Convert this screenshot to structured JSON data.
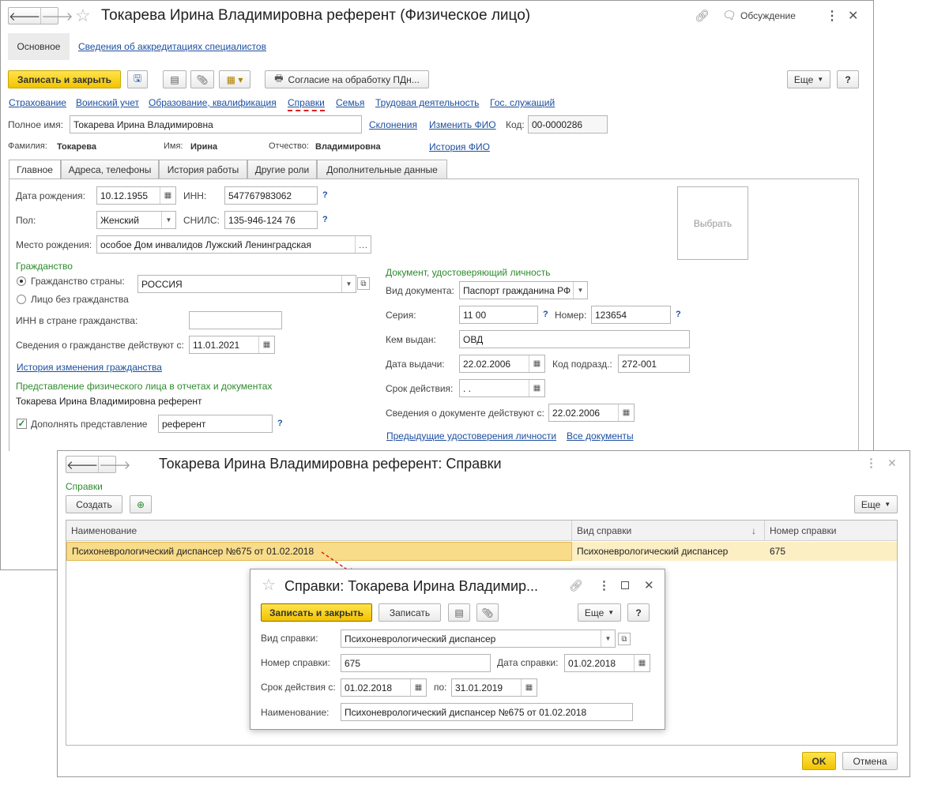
{
  "main": {
    "title": "Токарева Ирина Владимировна референт (Физическое лицо)",
    "discussion": "Обсуждение",
    "top_tabs": [
      "Основное",
      "Сведения об аккредитациях специалистов"
    ],
    "save_close": "Записать и закрыть",
    "consent": "Согласие на обработку ПДн...",
    "more": "Еще",
    "help": "?",
    "links": [
      "Страхование",
      "Воинский учет",
      "Образование, квалификация",
      "Справки",
      "Семья",
      "Трудовая деятельность",
      "Гос. служащий"
    ],
    "full_name_label": "Полное имя:",
    "full_name": "Токарева Ирина Владимировна",
    "declensions": "Склонения",
    "change_fio": "Изменить ФИО",
    "code_label": "Код:",
    "code": "00-0000286",
    "surname_label": "Фамилия:",
    "surname": "Токарева",
    "name_label": "Имя:",
    "name": "Ирина",
    "patronymic_label": "Отчество:",
    "patronymic": "Владимировна",
    "fio_history": "История ФИО",
    "tabs": [
      "Главное",
      "Адреса, телефоны",
      "История работы",
      "Другие роли",
      "Дополнительные данные"
    ],
    "birth_date_label": "Дата рождения:",
    "birth_date": "10.12.1955",
    "inn_label": "ИНН:",
    "inn": "547767983062",
    "sex_label": "Пол:",
    "sex": "Женский",
    "snils_label": "СНИЛС:",
    "snils": "135-946-124 76",
    "birth_place_label": "Место рождения:",
    "birth_place": "особое  Дом инвалидов  Лужский  Ленинградская",
    "photo": "Выбрать",
    "citizenship_header": "Гражданство",
    "citizenship_country_label": "Гражданство страны:",
    "citizenship_country": "РОССИЯ",
    "stateless_label": "Лицо без гражданства",
    "inn_foreign_label": "ИНН в стране гражданства:",
    "citizenship_since_label": "Сведения о гражданстве действуют с:",
    "citizenship_since": "11.01.2021",
    "citizenship_history": "История изменения гражданства",
    "representation_header": "Представление физического лица в отчетах и документах",
    "representation": "Токарева Ирина Владимировна референт",
    "supplement_label": "Дополнять представление",
    "supplement": "референт",
    "doc_header": "Документ, удостоверяющий личность",
    "doc_kind_label": "Вид документа:",
    "doc_kind": "Паспорт гражданина РФ",
    "series_label": "Серия:",
    "series": "11 00",
    "number_label": "Номер:",
    "number": "123654",
    "issued_by_label": "Кем выдан:",
    "issued_by": "ОВД",
    "issue_date_label": "Дата выдачи:",
    "issue_date": "22.02.2006",
    "dept_code_label": "Код подразд.:",
    "dept_code": "272-001",
    "valid_until_label": "Срок действия:",
    "valid_until": " .  .",
    "doc_since_label": "Сведения о документе действуют с:",
    "doc_since": "22.02.2006",
    "prev_docs": "Предыдущие удостоверения личности",
    "all_docs": "Все документы"
  },
  "list": {
    "title": "Токарева Ирина Владимировна референт: Справки",
    "section": "Справки",
    "create": "Создать",
    "more": "Еще",
    "columns": [
      "Наименование",
      "Вид справки",
      "Номер справки"
    ],
    "row": [
      "Психоневрологический диспансер №675 от 01.02.2018",
      "Психоневрологический диспансер",
      "675"
    ],
    "ok": "OK",
    "cancel": "Отмена"
  },
  "dialog": {
    "title": "Справки: Токарева Ирина Владимир...",
    "save_close": "Записать и закрыть",
    "save": "Записать",
    "more": "Еще",
    "help": "?",
    "kind_label": "Вид справки:",
    "kind": "Психоневрологический диспансер",
    "number_label": "Номер справки:",
    "number": "675",
    "date_label": "Дата справки:",
    "date": "01.02.2018",
    "valid_from_label": "Срок действия с:",
    "valid_from": "01.02.2018",
    "valid_to_label": "по:",
    "valid_to": "31.01.2019",
    "name_label": "Наименование:",
    "name": "Психоневрологический диспансер №675 от 01.02.2018"
  }
}
